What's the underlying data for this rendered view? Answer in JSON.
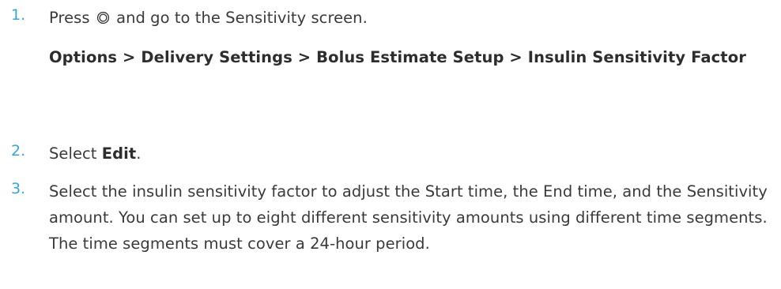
{
  "steps": [
    {
      "number": "1.",
      "text_before_icon": "Press",
      "icon": "menu-circle-icon",
      "text_after_icon": "and go to the Sensitivity screen.",
      "menu_path": "Options > Delivery Settings > Bolus Estimate Setup > Insulin Sensitivity Factor"
    },
    {
      "number": "2.",
      "text_before": "Select",
      "bold": "Edit",
      "text_after": "."
    },
    {
      "number": "3.",
      "text": "Select the insulin sensitivity factor to adjust the Start time, the End time, and the Sensitivity amount. You can set up to eight different sensitivity amounts using different time segments. The time segments must cover a 24-hour period."
    }
  ],
  "colors": {
    "step_number": "#3aa5d8",
    "body_text": "#3a3a3a",
    "bold_text": "#2d2d2d"
  }
}
